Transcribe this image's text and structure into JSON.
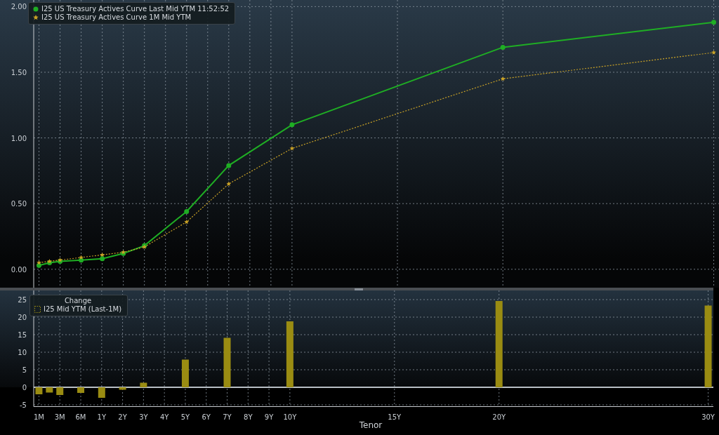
{
  "yield_curve_chart": {
    "chart_data": {
      "type": "line",
      "grid": true,
      "legend": "upper left",
      "categories": [
        null,
        null,
        null,
        null,
        null,
        null,
        null,
        null,
        null,
        null,
        null,
        null,
        null,
        null,
        null,
        null,
        null,
        null,
        null,
        null,
        null,
        null,
        null,
        null,
        null,
        null,
        null,
        null,
        null,
        null,
        null,
        null,
        null,
        null,
        null,
        null,
        null,
        null,
        null,
        null,
        null,
        null,
        null,
        null,
        null,
        null,
        null,
        null,
        null,
        null,
        null,
        null,
        null,
        null,
        null,
        null,
        null,
        null,
        null,
        null,
        null,
        null,
        null,
        null,
        null
      ],
      "ylim": [
        -0.14,
        2.05
      ],
      "yticks": [
        {
          "value": 0,
          "label": "0.00"
        },
        {
          "value": 0.5,
          "label": "0.50"
        },
        {
          "value": 1,
          "label": "1.00"
        },
        {
          "value": 1.5,
          "label": "1.50"
        },
        {
          "value": 2,
          "label": "2.00"
        }
      ],
      "series": [
        {
          "name": "I25 US Treasury Actives Curve Last Mid YTM 11:52:52",
          "color": "#1fae24",
          "line_style": "solid",
          "marker": "circle",
          "values": [
            0.03,
            0.05,
            0.06,
            null,
            0.07,
            null,
            0.08,
            null,
            0.12,
            null,
            0.18,
            null,
            null,
            null,
            0.44,
            null,
            null,
            null,
            0.79,
            null,
            null,
            null,
            null,
            null,
            1.1,
            null,
            null,
            null,
            null,
            null,
            null,
            null,
            null,
            null,
            null,
            null,
            null,
            null,
            null,
            null,
            null,
            null,
            null,
            null,
            1.69,
            null,
            null,
            null,
            null,
            null,
            null,
            null,
            null,
            null,
            null,
            null,
            null,
            null,
            null,
            null,
            null,
            null,
            null,
            null,
            1.88
          ]
        },
        {
          "name": "I25 US Treasury Actives Curve 1M Mid YTM",
          "color": "#c9a227",
          "line_style": "dashed",
          "marker": "star",
          "values": [
            0.05,
            0.06,
            0.07,
            null,
            0.09,
            null,
            0.11,
            null,
            0.13,
            null,
            0.17,
            null,
            null,
            null,
            0.36,
            null,
            null,
            null,
            0.65,
            null,
            null,
            null,
            null,
            null,
            0.92,
            null,
            null,
            null,
            null,
            null,
            null,
            null,
            null,
            null,
            null,
            null,
            null,
            null,
            null,
            null,
            null,
            null,
            null,
            null,
            1.45,
            null,
            null,
            null,
            null,
            null,
            null,
            null,
            null,
            null,
            null,
            null,
            null,
            null,
            null,
            null,
            null,
            null,
            null,
            null,
            1.65
          ]
        }
      ]
    }
  },
  "change_chart": {
    "chart_data": {
      "type": "bar",
      "title": "Change",
      "grid": true,
      "legend": "upper left",
      "xlabel": "Tenor",
      "categories": [
        "1M",
        null,
        "3M",
        null,
        "6M",
        null,
        "1Y",
        null,
        "2Y",
        null,
        "3Y",
        null,
        "4Y",
        null,
        "5Y",
        null,
        "6Y",
        null,
        "7Y",
        null,
        "8Y",
        null,
        "9Y",
        null,
        "10Y",
        null,
        null,
        null,
        null,
        null,
        null,
        null,
        null,
        null,
        "15Y",
        null,
        null,
        null,
        null,
        null,
        null,
        null,
        null,
        null,
        "20Y",
        null,
        null,
        null,
        null,
        null,
        null,
        null,
        null,
        null,
        null,
        null,
        null,
        null,
        null,
        null,
        null,
        null,
        null,
        null,
        "30Y"
      ],
      "yticks": [
        -5,
        0,
        5,
        10,
        15,
        20,
        25
      ],
      "ylim": [
        -5.5,
        27.6
      ],
      "series": [
        {
          "name": "I25 Mid YTM (Last-1M)",
          "color": "#9a8c12",
          "values": [
            -2,
            -1.5,
            -2.2,
            null,
            -1.6,
            null,
            -3,
            null,
            -0.7,
            null,
            1.3,
            null,
            null,
            null,
            7.9,
            null,
            null,
            null,
            14.1,
            null,
            null,
            null,
            null,
            null,
            18.8,
            null,
            null,
            null,
            null,
            null,
            null,
            null,
            null,
            null,
            null,
            null,
            null,
            null,
            null,
            null,
            null,
            null,
            null,
            null,
            24.6,
            null,
            null,
            null,
            null,
            null,
            null,
            null,
            null,
            null,
            null,
            null,
            null,
            null,
            null,
            null,
            null,
            null,
            null,
            null,
            23.3
          ]
        }
      ]
    }
  }
}
